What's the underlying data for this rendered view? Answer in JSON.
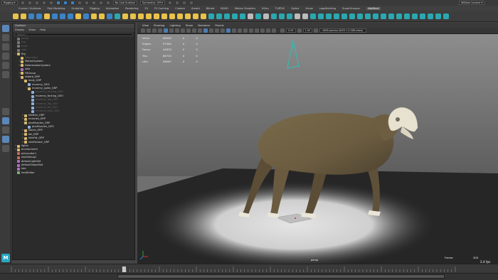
{
  "topbar": {
    "workspace": "Rigging",
    "live_surface": "No Live Surface",
    "symmetry": "Symmetry: Off",
    "user": "William Leneve"
  },
  "menu_tabs": [
    "Curves / Surfaces",
    "Poly Modeling",
    "Sculpting",
    "Rigging",
    "Animation",
    "Rendering",
    "FX",
    "FX Caching",
    "Custom",
    "Arnold",
    "Bifrost",
    "MASH",
    "Motion Graphics",
    "XGen",
    "TURTLE",
    "Spline",
    "Arrow",
    "cageBuilding",
    "SuperGrouper",
    "AdvSkull"
  ],
  "menu_active": "AdvSkull",
  "outliner": {
    "title": "Outliner",
    "menu": [
      "Display",
      "Show",
      "Help"
    ],
    "search_placeholder": "Search...",
    "items": [
      {
        "label": "persp",
        "indent": 1,
        "dim": true,
        "exp": "",
        "icon": "camera"
      },
      {
        "label": "top",
        "indent": 1,
        "dim": true,
        "exp": "",
        "icon": "camera"
      },
      {
        "label": "front",
        "indent": 1,
        "dim": true,
        "exp": "",
        "icon": "camera"
      },
      {
        "label": "side",
        "indent": 1,
        "dim": true,
        "exp": "",
        "icon": "camera"
      },
      {
        "label": "Rig",
        "indent": 1,
        "dim": false,
        "exp": "−",
        "icon": "group"
      },
      {
        "label": "Geometry",
        "indent": 2,
        "dim": true,
        "exp": "",
        "icon": "group"
      },
      {
        "label": "MotionSystem",
        "indent": 2,
        "dim": false,
        "exp": "+",
        "icon": "group"
      },
      {
        "label": "DeformationSystem",
        "indent": 2,
        "dim": false,
        "exp": "+",
        "icon": "group"
      },
      {
        "label": "sets",
        "indent": 2,
        "dim": false,
        "exp": "",
        "icon": "set"
      },
      {
        "label": "FitGroup",
        "indent": 2,
        "dim": false,
        "exp": "+",
        "icon": "group"
      },
      {
        "label": "rebarb_GRP",
        "indent": 2,
        "dim": false,
        "exp": "−",
        "icon": "group"
      },
      {
        "label": "body_GRP",
        "indent": 3,
        "dim": false,
        "exp": "−",
        "icon": "group"
      },
      {
        "label": "mummy_GEO",
        "indent": 4,
        "dim": false,
        "exp": "",
        "icon": "mesh"
      },
      {
        "label": "mummy_spike_GRP",
        "indent": 4,
        "dim": false,
        "exp": "−",
        "icon": "group"
      },
      {
        "label": "mummy_forking_GEO",
        "indent": 5,
        "dim": true,
        "exp": "",
        "icon": "mesh"
      },
      {
        "label": "mummy_forking_GEO",
        "indent": 5,
        "dim": false,
        "exp": "",
        "icon": "mesh"
      },
      {
        "label": "mummy_leg_GEO",
        "indent": 5,
        "dim": true,
        "exp": "",
        "icon": "mesh"
      },
      {
        "label": "mummy_leg_GEO",
        "indent": 5,
        "dim": true,
        "exp": "",
        "icon": "mesh"
      },
      {
        "label": "mummy_fat_GEO",
        "indent": 5,
        "dim": true,
        "exp": "",
        "icon": "mesh"
      },
      {
        "label": "mummy_skin_GEO",
        "indent": 5,
        "dim": true,
        "exp": "",
        "icon": "mesh"
      },
      {
        "label": "teether_GRP",
        "indent": 3,
        "dim": false,
        "exp": "+",
        "icon": "group"
      },
      {
        "label": "muscles_GRP",
        "indent": 3,
        "dim": false,
        "exp": "+",
        "icon": "group"
      },
      {
        "label": "phoMuscles_GRP",
        "indent": 3,
        "dim": false,
        "exp": "−",
        "icon": "group"
      },
      {
        "label": "phoMuscles_GEO",
        "indent": 4,
        "dim": false,
        "exp": "",
        "icon": "mesh"
      },
      {
        "label": "fascia_GRP",
        "indent": 3,
        "dim": false,
        "exp": "+",
        "icon": "group"
      },
      {
        "label": "fat_GRP",
        "indent": 3,
        "dim": false,
        "exp": "+",
        "icon": "group"
      },
      {
        "label": "skinFat_GRP",
        "indent": 3,
        "dim": false,
        "exp": "+",
        "icon": "group"
      },
      {
        "label": "skinRender_GRP",
        "indent": 3,
        "dim": false,
        "exp": "+",
        "icon": "group"
      },
      {
        "label": "lights",
        "indent": 1,
        "dim": false,
        "exp": "+",
        "icon": "group"
      },
      {
        "label": "environment",
        "indent": 1,
        "dim": false,
        "exp": "+",
        "icon": "group"
      },
      {
        "label": "pleLocator1",
        "indent": 1,
        "dim": false,
        "exp": "",
        "icon": "locator"
      },
      {
        "label": "skinDebug1",
        "indent": 1,
        "dim": false,
        "exp": "",
        "icon": "locator"
      },
      {
        "label": "defaultLightSet",
        "indent": 1,
        "dim": false,
        "exp": "",
        "icon": "set"
      },
      {
        "label": "defaultObjectSet",
        "indent": 1,
        "dim": false,
        "exp": "",
        "icon": "set"
      },
      {
        "label": "lolo",
        "indent": 1,
        "dim": false,
        "exp": "",
        "icon": "set"
      },
      {
        "label": "heatEditor",
        "indent": 1,
        "dim": false,
        "exp": "",
        "icon": "node"
      }
    ]
  },
  "viewport": {
    "menu": [
      "View",
      "Shading",
      "Lighting",
      "Show",
      "Renderer",
      "Panels"
    ],
    "exposure": "0.00",
    "gamma": "1.00",
    "color_space": "sRGB gamma (ACES 1.0 SDR-video)",
    "hud": [
      {
        "label": "Verts:",
        "a": "68500",
        "b": "0",
        "c": "0"
      },
      {
        "label": "Edges:",
        "a": "97464",
        "b": "0",
        "c": "0"
      },
      {
        "label": "Faces:",
        "a": "44833",
        "b": "0",
        "c": "0"
      },
      {
        "label": "Tris:",
        "a": "86720",
        "b": "0",
        "c": "0"
      },
      {
        "label": "UVs:",
        "a": "58087",
        "b": "0",
        "c": "0"
      }
    ],
    "camera": "persp",
    "frames_label": "Frame:",
    "frame": "308",
    "fps": "2.4 fps"
  },
  "timeline": {
    "ticks": [
      "10",
      "20",
      "30",
      "40",
      "50",
      "60",
      "70",
      "80",
      "90",
      "100",
      "110",
      "120"
    ]
  },
  "colors": {
    "accent": "#2aa8c5",
    "selection": "#3e5b7a",
    "skin": "#6d5f44",
    "bone": "#e7e1cf"
  },
  "icons": [
    "select-tool-icon",
    "move-tool-icon",
    "rotate-tool-icon",
    "scale-tool-icon",
    "lasso-icon",
    "paint-icon",
    "render-icon",
    "camera-icon",
    "locator-icon",
    "mesh-icon",
    "group-icon",
    "set-icon",
    "maya-logo-icon"
  ]
}
